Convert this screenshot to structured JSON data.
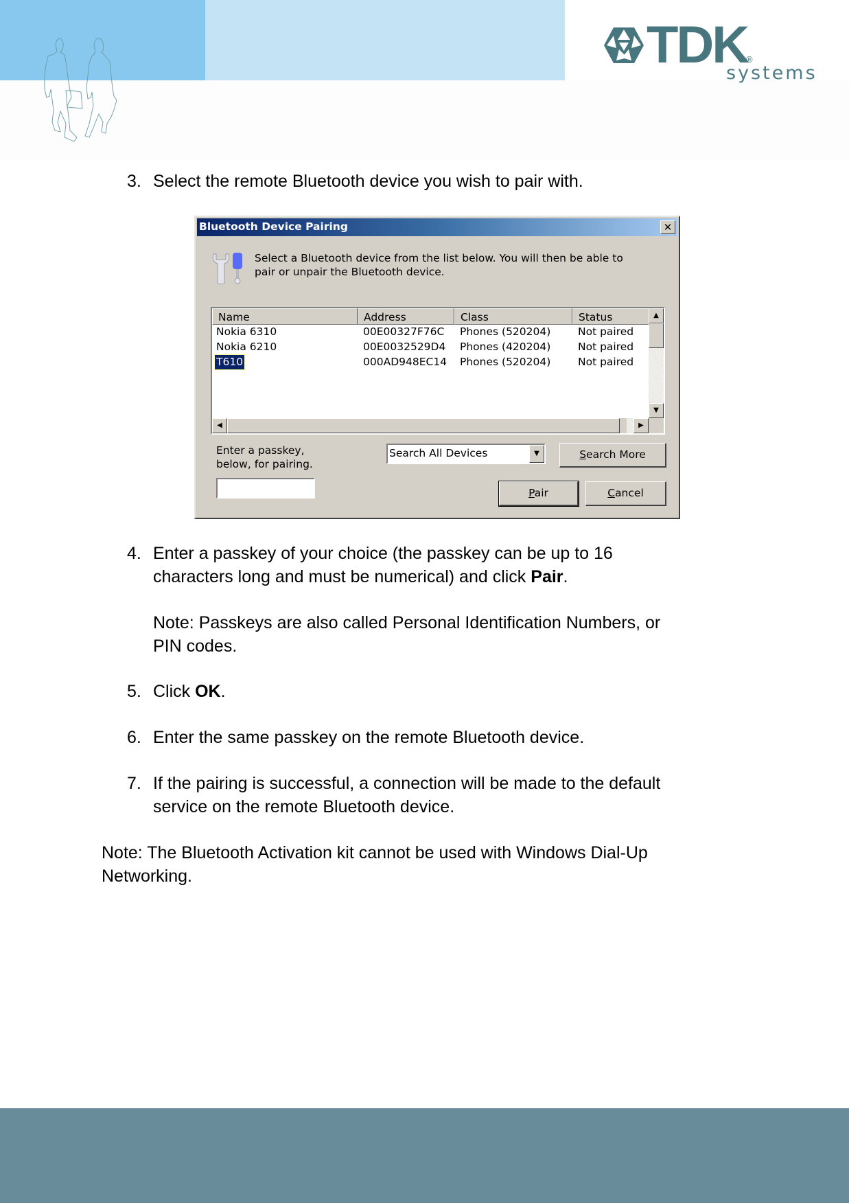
{
  "header": {
    "brand_name": "TDK",
    "brand_registered": "®",
    "brand_sub": "systems",
    "colors": {
      "band_dark": "#89c8ee",
      "band_light": "#c4e4f6",
      "brand": "#48767f"
    }
  },
  "steps": [
    {
      "num": "3.",
      "text": "Select the remote Bluetooth device you wish to pair with."
    },
    {
      "num": "4.",
      "line1": "Enter a passkey of your choice (the passkey can be up to 16",
      "line2_pre": "characters long and must be numerical) and click ",
      "line2_bold": "Pair",
      "line2_post": ".",
      "note_line1": "Note: Passkeys are also called Personal Identification Numbers, or",
      "note_line2": "PIN codes."
    },
    {
      "num": "5.",
      "pre": "Click ",
      "bold": "OK",
      "post": "."
    },
    {
      "num": "6.",
      "text": "Enter the same passkey on the remote Bluetooth device."
    },
    {
      "num": "7.",
      "line1": "If the pairing is successful, a connection will be made to the default",
      "line2": "service on the remote Bluetooth device."
    }
  ],
  "final_note": {
    "line1": "Note: The Bluetooth Activation kit cannot be used with Windows Dial-Up",
    "line2": "Networking."
  },
  "dialog": {
    "title": "Bluetooth Device Pairing",
    "close_glyph": "✕",
    "intro_line1": "Select a Bluetooth device from the list below. You will then be able to",
    "intro_line2": "pair or unpair the Bluetooth device.",
    "columns": [
      "Name",
      "Address",
      "Class",
      "Status"
    ],
    "devices": [
      {
        "name": "Nokia 6310",
        "address": "00E00327F76C",
        "class": "Phones (520204)",
        "status": "Not paired",
        "selected": false
      },
      {
        "name": "Nokia 6210",
        "address": "00E0032529D4",
        "class": "Phones (420204)",
        "status": "Not paired",
        "selected": false
      },
      {
        "name": "T610",
        "address": "000AD948EC14",
        "class": "Phones (520204)",
        "status": "Not paired",
        "selected": true
      }
    ],
    "scroll_up": "▲",
    "scroll_down": "▼",
    "scroll_left": "◀",
    "scroll_right": "▶",
    "passkey_label_line1": "Enter a passkey,",
    "passkey_label_line2": "below, for pairing.",
    "passkey_value": "",
    "filter_selected": "Search All Devices",
    "filter_arrow": "▼",
    "search_more": {
      "accel": "S",
      "rest": "earch More"
    },
    "pair": {
      "accel": "P",
      "rest": "air"
    },
    "cancel": {
      "accel": "C",
      "rest": "ancel"
    }
  },
  "footer": {
    "color": "#698c9a"
  }
}
